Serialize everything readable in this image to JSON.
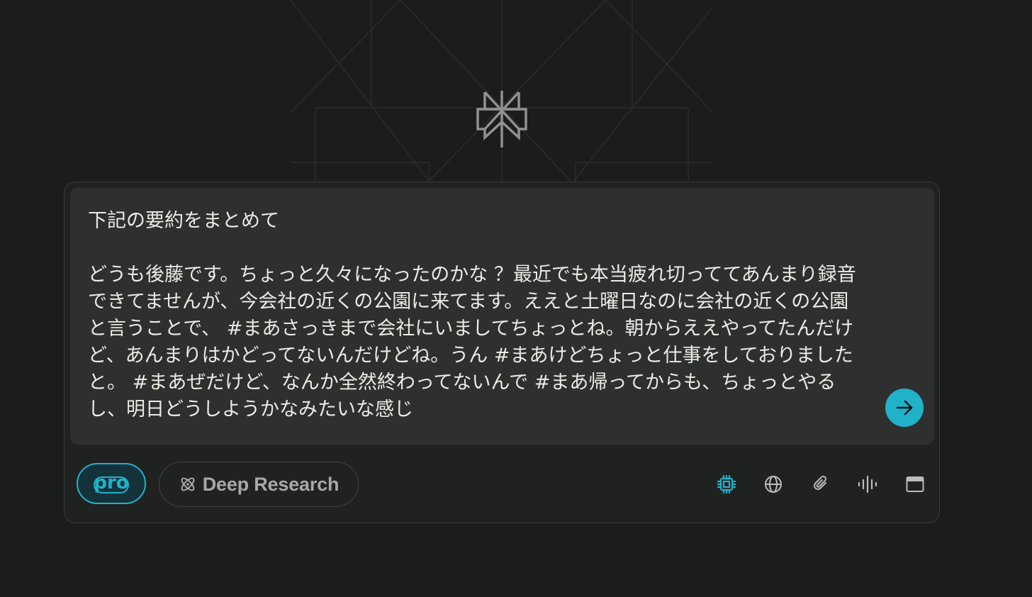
{
  "prompt": {
    "text": "下記の要約をまとめて\n\nどうも後藤です。ちょっと久々になったのかな ？最近でも本当疲れ切っててあんまり録音できてませんが、今会社の近くの公園に来てます。ええと土曜日なのに会社の近くの公園と言うことで、 #まあさっきまで会社にいましてちょっとね。朝からええやってたんだけど、あんまりはかどってないんだけどね。うん #まあけどちょっと仕事をしておりましたと。 #まあぜだけど、なんか全然終わってないんで #まあ帰ってからも、ちょっとやるし、明日どうしようかなみたいな感じ"
  },
  "toolbar": {
    "pro_label": "pro",
    "deep_research_label": "Deep Research"
  },
  "icons": {
    "logo": "perplexity-logo",
    "send": "arrow-right-icon",
    "pro": "pro-icon",
    "deep_research": "atom-icon",
    "tools": [
      "chip-icon",
      "globe-icon",
      "paperclip-icon",
      "waveform-icon",
      "window-icon"
    ]
  },
  "colors": {
    "background": "#1b1c1c",
    "input_background": "#2e302f",
    "accent": "#1fb2c9",
    "text": "#eceae4",
    "muted": "#a6a9a6"
  }
}
